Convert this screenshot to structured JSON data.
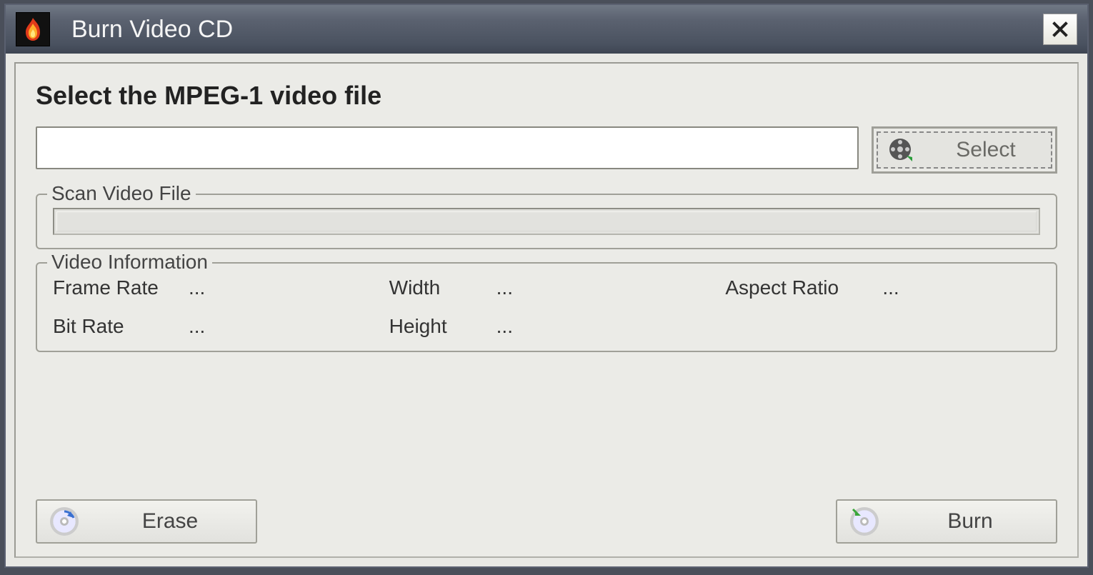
{
  "titlebar": {
    "title": "Burn Video CD",
    "close_label": "×"
  },
  "main": {
    "heading": "Select the MPEG-1 video file",
    "file_value": "",
    "select_label": "Select"
  },
  "scan": {
    "legend": "Scan Video File"
  },
  "info": {
    "legend": "Video Information",
    "frame_rate_label": "Frame Rate",
    "frame_rate_value": "...",
    "bit_rate_label": "Bit Rate",
    "bit_rate_value": "...",
    "width_label": "Width",
    "width_value": "...",
    "height_label": "Height",
    "height_value": "...",
    "aspect_ratio_label": "Aspect Ratio",
    "aspect_ratio_value": "..."
  },
  "footer": {
    "erase_label": "Erase",
    "burn_label": "Burn"
  }
}
